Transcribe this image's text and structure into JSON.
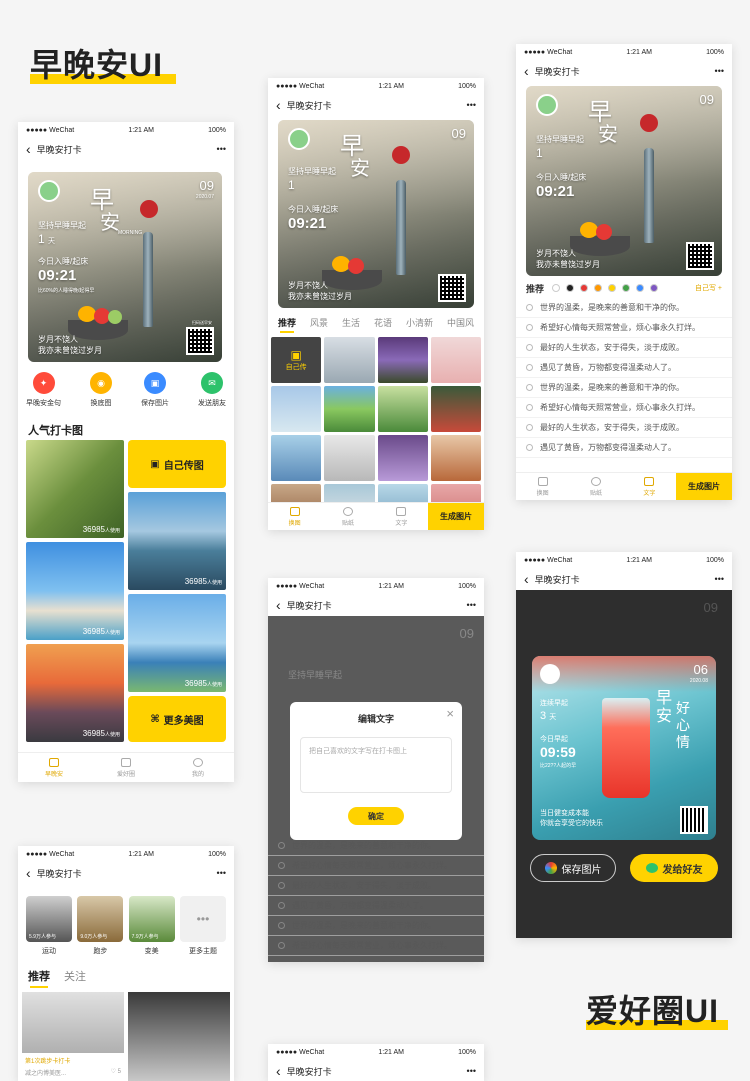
{
  "titles": {
    "morning": "早晚安UI",
    "hobby": "爱好圈UI"
  },
  "status": {
    "carrier": "●●●●● WeChat",
    "time": "1:21 AM",
    "battery": "100%"
  },
  "nav": {
    "title": "早晚安打卡",
    "more": "•••",
    "back": "‹"
  },
  "card": {
    "day": "09",
    "date": "2020.07",
    "zao": "早",
    "an": "安",
    "good": "GOOD",
    "morning": "MORNING",
    "keep": "坚持早睡早起",
    "days_num": "1",
    "days_unit": "天",
    "today": "今日入睡/起床",
    "time": "09:21",
    "pct": "比60%的人睡得晚/起得早",
    "quote1": "岁月不饶人",
    "quote2": "我亦未曾饶过岁月",
    "scan": "扫码送早安"
  },
  "actions": [
    {
      "label": "早晚安金句",
      "color": "#ff4b3a",
      "glyph": "✦"
    },
    {
      "label": "换底图",
      "color": "#ffb400",
      "glyph": "◉"
    },
    {
      "label": "保存图片",
      "color": "#3a8bff",
      "glyph": "▣"
    },
    {
      "label": "发送朋友",
      "color": "#2dc26b",
      "glyph": "✉"
    }
  ],
  "popular": {
    "title": "人气打卡图",
    "count": "36985",
    "used": "人使用",
    "upload": "自己传图",
    "more": "更多美图"
  },
  "bottom_home": [
    {
      "label": "早晚安"
    },
    {
      "label": "爱好圈"
    },
    {
      "label": "我的"
    }
  ],
  "bg_tabs": [
    "推荐",
    "风景",
    "生活",
    "花语",
    "小清新",
    "中国风"
  ],
  "bg_self": "自己传",
  "tools": [
    {
      "label": "换图"
    },
    {
      "label": "贴纸"
    },
    {
      "label": "文字"
    }
  ],
  "generate": "生成图片",
  "text_tab": "推荐",
  "self_write": "自己写 +",
  "colors": [
    "#ffffff",
    "#222222",
    "#e53935",
    "#ff9800",
    "#ffd200",
    "#43a047",
    "#3a8bff",
    "#7e57c2"
  ],
  "quotes": [
    "世界的温柔，是晚来的善意和干净的你。",
    "希望好心情每天照常营业，烦心事永久打烊。",
    "最好的人生状态，安于得失，淡于成败。",
    "遇见了黄昏，万物都变得温柔动人了。",
    "世界的温柔，是晚来的善意和干净的你。",
    "希望好心情每天照常营业，烦心事永久打烊。",
    "最好的人生状态，安于得失，淡于成败。",
    "遇见了黄昏，万物都变得温柔动人了。"
  ],
  "dialog": {
    "title": "编辑文字",
    "placeholder": "把自己喜欢的文字写在打卡图上",
    "confirm": "确定",
    "close": "×"
  },
  "share": {
    "day": "06",
    "date": "2020.08",
    "zao": "早",
    "an": "安",
    "hao": "好",
    "xin": "心",
    "qing": "情",
    "keep": "连续早起",
    "days": "3",
    "unit": "天",
    "today": "今日早起",
    "time": "09:59",
    "pct": "比22??人起的早",
    "slogan1": "当日健变成本能",
    "slogan2": "你就会享受它的快乐",
    "save": "保存图片",
    "send": "发给好友"
  },
  "hobby": {
    "topics": [
      {
        "label": "运动",
        "sub": "5.9万人参与"
      },
      {
        "label": "跑步",
        "sub": "9.0万人参与"
      },
      {
        "label": "变美",
        "sub": "7.9万人参与"
      },
      {
        "label": "更多主题",
        "sub": ""
      }
    ],
    "tabs": [
      "推荐",
      "关注"
    ],
    "post_tag": "第1次跳步卡打卡",
    "post_user": "减之内博美医...",
    "likes": "5"
  }
}
